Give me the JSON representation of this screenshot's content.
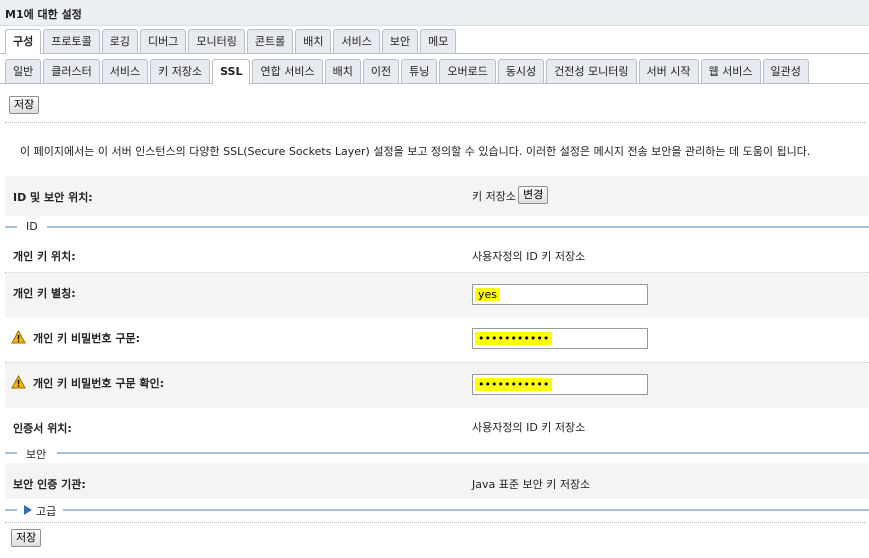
{
  "window": {
    "title": "M1에 대한 설정"
  },
  "tabs_primary": [
    {
      "label": "구성",
      "active": true
    },
    {
      "label": "프로토콜"
    },
    {
      "label": "로깅"
    },
    {
      "label": "디버그"
    },
    {
      "label": "모니터링"
    },
    {
      "label": "콘트롤"
    },
    {
      "label": "배치"
    },
    {
      "label": "서비스"
    },
    {
      "label": "보안"
    },
    {
      "label": "메모"
    }
  ],
  "tabs_secondary": [
    {
      "label": "일반"
    },
    {
      "label": "클러스터"
    },
    {
      "label": "서비스"
    },
    {
      "label": "키 저장소"
    },
    {
      "label": "SSL",
      "active": true
    },
    {
      "label": "연합 서비스"
    },
    {
      "label": "배치"
    },
    {
      "label": "이전"
    },
    {
      "label": "튜닝"
    },
    {
      "label": "오버로드"
    },
    {
      "label": "동시성"
    },
    {
      "label": "건전성 모니터링"
    },
    {
      "label": "서버 시작"
    },
    {
      "label": "웹 서비스"
    },
    {
      "label": "일관성"
    }
  ],
  "actions": {
    "save_label": "저장",
    "change_label": "변경"
  },
  "description": "이 페이지에서는 이 서버 인스턴스의 다양한 SSL(Secure Sockets Layer) 설정을 보고 정의할 수 있습니다. 이러한 설정은 메시지 전송 보안을 관리하는 데 도움이 됩니다.",
  "identity_location": {
    "label": "ID 및 보안 위치:",
    "value": "키 저장소"
  },
  "sections": {
    "identity": "ID",
    "trust": "보안",
    "advanced": "고급"
  },
  "fields": {
    "private_key_location": {
      "label": "개인 키 위치:",
      "value": "사용자정의 ID 키 저장소"
    },
    "private_key_alias": {
      "label": "개인 키 별칭:",
      "value": "yes"
    },
    "passphrase": {
      "label": "개인 키 비밀번호 구문:",
      "value": "•••••••••••"
    },
    "passphrase_confirm": {
      "label": "개인 키 비밀번호 구문 확인:",
      "value": "•••••••••••"
    },
    "certificate_location": {
      "label": "인증서 위치:",
      "value": "사용자정의 ID 키 저장소"
    },
    "trusted_ca": {
      "label": "보안 인증 기관:",
      "value": "Java 표준 보안 키 저장소"
    }
  },
  "colors": {
    "highlight": "#ffff00",
    "section_line": "#a9bfd6",
    "shade": "#f4f4f4"
  }
}
